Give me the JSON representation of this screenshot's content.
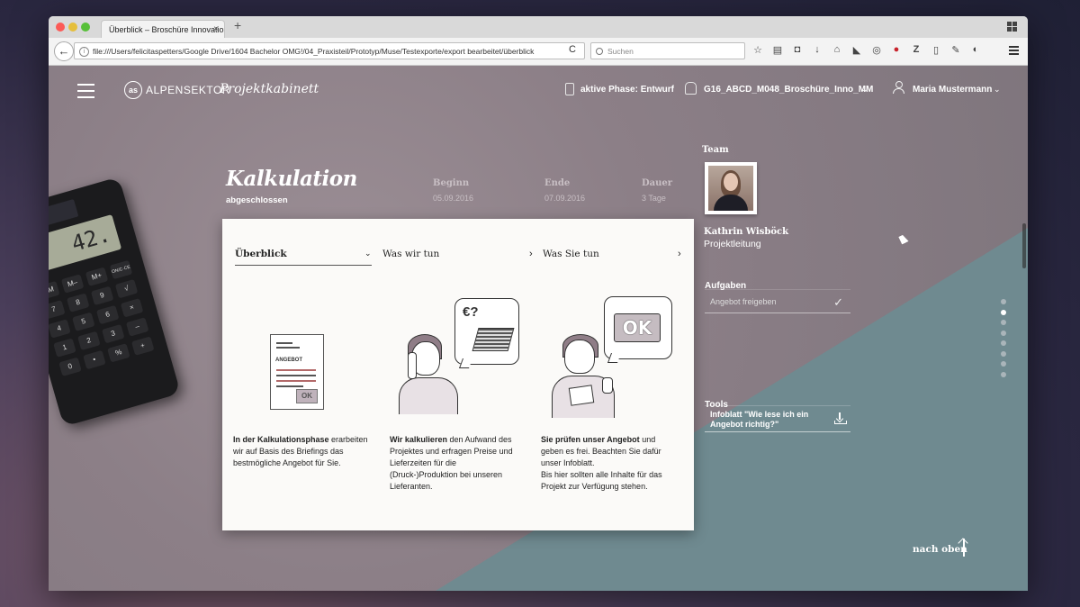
{
  "browser": {
    "tab_title": "Überblick – Broschüre Innovatio...",
    "tab_close": "×",
    "new_tab": "+",
    "url": "file:///Users/felicitaspetters/Google Drive/1604 Bachelor OMG!/04_Praxisteil/Prototyp/Muse/Testexporte/export bearbeitet/überblick",
    "search_placeholder": "Suchen",
    "back": "←",
    "reload": "C"
  },
  "header": {
    "brand": "ALPENSEKTOR",
    "brand_sub": "Projektkabinett",
    "phase": "aktive Phase: Entwurf",
    "project": "G16_ABCD_M048_Broschüre_Inno_MM",
    "user": "Maria Mustermann"
  },
  "calculator": {
    "display": "42.",
    "keys": [
      "RM",
      "M–",
      "M+",
      "ON/C·CE",
      "7",
      "8",
      "9",
      "√",
      "4",
      "5",
      "6",
      "×",
      "1",
      "2",
      "3",
      "–",
      "0",
      "•",
      "%",
      "+"
    ]
  },
  "phase_info": {
    "title": "Kalkulation",
    "status": "abgeschlossen",
    "begin_label": "Beginn",
    "begin_value": "05.09.2016",
    "end_label": "Ende",
    "end_value": "07.09.2016",
    "duration_label": "Dauer",
    "duration_value": "3 Tage"
  },
  "card": {
    "tabs": [
      "Überblick",
      "Was wir tun",
      "Was Sie tun"
    ],
    "doc_label": "ANGEBOT",
    "ok_label": "OK",
    "bubble1": "€?",
    "bubble2": "OK",
    "columns": [
      {
        "bold": "In der Kalkulationsphase",
        "text": " erarbeiten wir auf Basis des Briefings das bestmögliche Angebot für Sie."
      },
      {
        "bold": "Wir kalkulieren",
        "text": " den Aufwand des Projektes und erfragen Preise und Lieferzeiten für die (Druck-)Produktion bei unseren Lieferanten."
      },
      {
        "bold": "Sie prüfen unser Angebot",
        "text": " und geben es frei. Beachten Sie dafür unser Infoblatt.",
        "text2": "Bis hier sollten alle Inhalte für das Projekt zur Verfügung stehen."
      }
    ]
  },
  "sidebar": {
    "team_label": "Team",
    "member_name": "Kathrin Wisböck",
    "member_role": "Projektleitung",
    "tasks_label": "Aufgaben",
    "task": "Angebot freigeben",
    "task_check": "✓",
    "tools_label": "Tools",
    "tool": "Infoblatt \"Wie lese ich ein Angebot richtig?\""
  },
  "pagination": {
    "count": 8,
    "active_index": 1
  },
  "footer": {
    "nach_oben": "nach oben"
  }
}
